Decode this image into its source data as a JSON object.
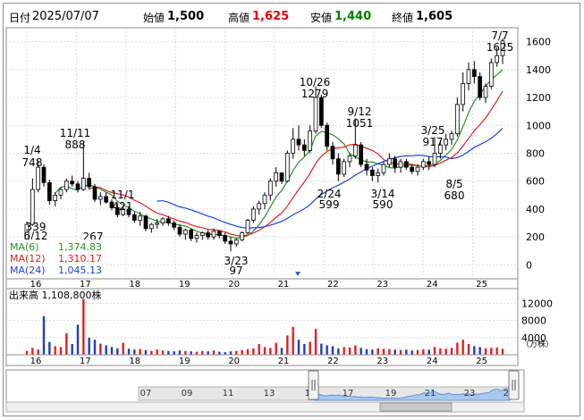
{
  "header": {
    "date_label": "日付",
    "date_value": "2025/07/07",
    "open_label": "始値",
    "open_value": "1,500",
    "high_label": "高値",
    "high_value": "1,625",
    "low_label": "安値",
    "low_value": "1,440",
    "close_label": "終値",
    "close_value": "1,605",
    "high_color": "#e60000",
    "low_color": "#008000"
  },
  "chart_data": [
    {
      "type": "candlestick",
      "y_axis_ticks": [
        "0",
        "200",
        "400",
        "600",
        "800",
        "1000",
        "1200",
        "1400",
        "1600"
      ],
      "ylim": [
        0,
        1700
      ],
      "x_axis_ticks": [
        "16",
        "17",
        "18",
        "19",
        "20",
        "21",
        "22",
        "23",
        "24",
        "25"
      ],
      "annotations": [
        {
          "date": "1/4",
          "value": "748"
        },
        {
          "date": "11/11",
          "value": "888"
        },
        {
          "date": "11/1",
          "value": "421"
        },
        {
          "date": "",
          "value": "267"
        },
        {
          "date": "",
          "value": "339"
        },
        {
          "date": "6/12",
          "value": ""
        },
        {
          "date": "3/23",
          "value": "97"
        },
        {
          "date": "10/26",
          "value": "1279"
        },
        {
          "date": "9/12",
          "value": "1051"
        },
        {
          "date": "2/24",
          "value": "599"
        },
        {
          "date": "3/14",
          "value": "590"
        },
        {
          "date": "3/25",
          "value": "917"
        },
        {
          "date": "8/5",
          "value": "680"
        },
        {
          "date": "7/7",
          "value": "1625"
        }
      ],
      "legend": [
        {
          "label": "MA(6)",
          "value": "1,374.83",
          "color": "#2e8b2e"
        },
        {
          "label": "MA(12)",
          "value": "1,310.17",
          "color": "#e02020"
        },
        {
          "label": "MA(24)",
          "value": "1,045.13",
          "color": "#2040e0"
        }
      ],
      "candles": [
        [
          160,
          310,
          150,
          290
        ],
        [
          290,
          620,
          280,
          540
        ],
        [
          540,
          748,
          520,
          700
        ],
        [
          700,
          720,
          560,
          590
        ],
        [
          590,
          610,
          430,
          460
        ],
        [
          460,
          520,
          420,
          500
        ],
        [
          500,
          560,
          470,
          540
        ],
        [
          540,
          620,
          520,
          600
        ],
        [
          600,
          640,
          560,
          580
        ],
        [
          580,
          600,
          520,
          540
        ],
        [
          540,
          888,
          530,
          620
        ],
        [
          620,
          660,
          540,
          560
        ],
        [
          560,
          580,
          450,
          470
        ],
        [
          470,
          520,
          430,
          490
        ],
        [
          490,
          520,
          440,
          450
        ],
        [
          450,
          470,
          390,
          410
        ],
        [
          410,
          440,
          340,
          360
        ],
        [
          360,
          421,
          350,
          400
        ],
        [
          400,
          420,
          340,
          360
        ],
        [
          360,
          380,
          300,
          320
        ],
        [
          320,
          380,
          280,
          350
        ],
        [
          350,
          360,
          240,
          260
        ],
        [
          260,
          300,
          230,
          290
        ],
        [
          290,
          330,
          260,
          300
        ],
        [
          300,
          340,
          280,
          330
        ],
        [
          330,
          350,
          280,
          300
        ],
        [
          300,
          320,
          250,
          270
        ],
        [
          270,
          290,
          200,
          220
        ],
        [
          220,
          260,
          180,
          250
        ],
        [
          250,
          260,
          170,
          190
        ],
        [
          190,
          230,
          160,
          210
        ],
        [
          210,
          240,
          180,
          230
        ],
        [
          230,
          250,
          180,
          200
        ],
        [
          200,
          260,
          180,
          240
        ],
        [
          240,
          250,
          190,
          210
        ],
        [
          210,
          230,
          150,
          170
        ],
        [
          170,
          200,
          97,
          150
        ],
        [
          150,
          190,
          130,
          180
        ],
        [
          180,
          240,
          170,
          230
        ],
        [
          230,
          330,
          220,
          320
        ],
        [
          320,
          420,
          300,
          400
        ],
        [
          400,
          460,
          360,
          440
        ],
        [
          440,
          520,
          400,
          500
        ],
        [
          500,
          620,
          460,
          600
        ],
        [
          600,
          700,
          560,
          660
        ],
        [
          660,
          640,
          580,
          600
        ],
        [
          600,
          820,
          590,
          800
        ],
        [
          800,
          980,
          760,
          900
        ],
        [
          900,
          1000,
          820,
          860
        ],
        [
          860,
          900,
          780,
          820
        ],
        [
          820,
          1000,
          800,
          960
        ],
        [
          960,
          1279,
          940,
          1200
        ],
        [
          1200,
          1220,
          980,
          1000
        ],
        [
          1000,
          1020,
          820,
          850
        ],
        [
          850,
          880,
          720,
          760
        ],
        [
          760,
          800,
          599,
          650
        ],
        [
          650,
          760,
          630,
          740
        ],
        [
          740,
          800,
          700,
          780
        ],
        [
          780,
          1051,
          760,
          860
        ],
        [
          860,
          880,
          700,
          720
        ],
        [
          720,
          760,
          640,
          680
        ],
        [
          680,
          700,
          600,
          640
        ],
        [
          640,
          690,
          590,
          660
        ],
        [
          660,
          740,
          640,
          720
        ],
        [
          720,
          800,
          700,
          760
        ],
        [
          760,
          780,
          660,
          700
        ],
        [
          700,
          760,
          660,
          740
        ],
        [
          740,
          760,
          680,
          700
        ],
        [
          700,
          720,
          650,
          670
        ],
        [
          670,
          720,
          640,
          700
        ],
        [
          700,
          760,
          680,
          740
        ],
        [
          740,
          780,
          680,
          720
        ],
        [
          720,
          917,
          700,
          800
        ],
        [
          800,
          880,
          760,
          860
        ],
        [
          860,
          940,
          820,
          900
        ],
        [
          900,
          960,
          860,
          940
        ],
        [
          940,
          1200,
          920,
          1150
        ],
        [
          1150,
          1380,
          1100,
          1300
        ],
        [
          1300,
          1450,
          1250,
          1400
        ],
        [
          1400,
          1460,
          1300,
          1350
        ],
        [
          1350,
          1380,
          1180,
          1200
        ],
        [
          1200,
          1300,
          1160,
          1280
        ],
        [
          1280,
          1480,
          1260,
          1450
        ],
        [
          1450,
          1560,
          1420,
          1500
        ],
        [
          1500,
          1625,
          1440,
          1605
        ]
      ],
      "volume_axis_ticks": [
        "4000",
        "8000",
        "12000"
      ],
      "volume_label": "出来高",
      "volume_value": "1,108,800株",
      "volume_unit": "（万株）",
      "volume": [
        900,
        1600,
        1200,
        9000,
        3000,
        2000,
        1800,
        5000,
        2500,
        7000,
        13000,
        4000,
        3500,
        2600,
        2200,
        1800,
        1500,
        2800,
        1400,
        1200,
        1300,
        1100,
        900,
        1200,
        1000,
        900,
        800,
        1000,
        900,
        800,
        700,
        900,
        800,
        1000,
        700,
        600,
        800,
        900,
        1100,
        1300,
        1500,
        2500,
        1800,
        1600,
        2800,
        1600,
        4500,
        6500,
        3500,
        2500,
        3000,
        6000,
        2600,
        2200,
        2000,
        1500,
        1800,
        1700,
        2200,
        1600,
        1300,
        1200,
        1500,
        1400,
        1300,
        1200,
        1100,
        1200,
        1000,
        1100,
        1300,
        1200,
        1800,
        1500,
        1400,
        1600,
        2800,
        3500,
        2500,
        2000,
        1800,
        1500,
        1600,
        1700,
        1400
      ]
    }
  ],
  "navigator": {
    "ticks": [
      "07",
      "09",
      "11",
      "13",
      "15",
      "17",
      "19",
      "21",
      "23",
      "25"
    ]
  }
}
